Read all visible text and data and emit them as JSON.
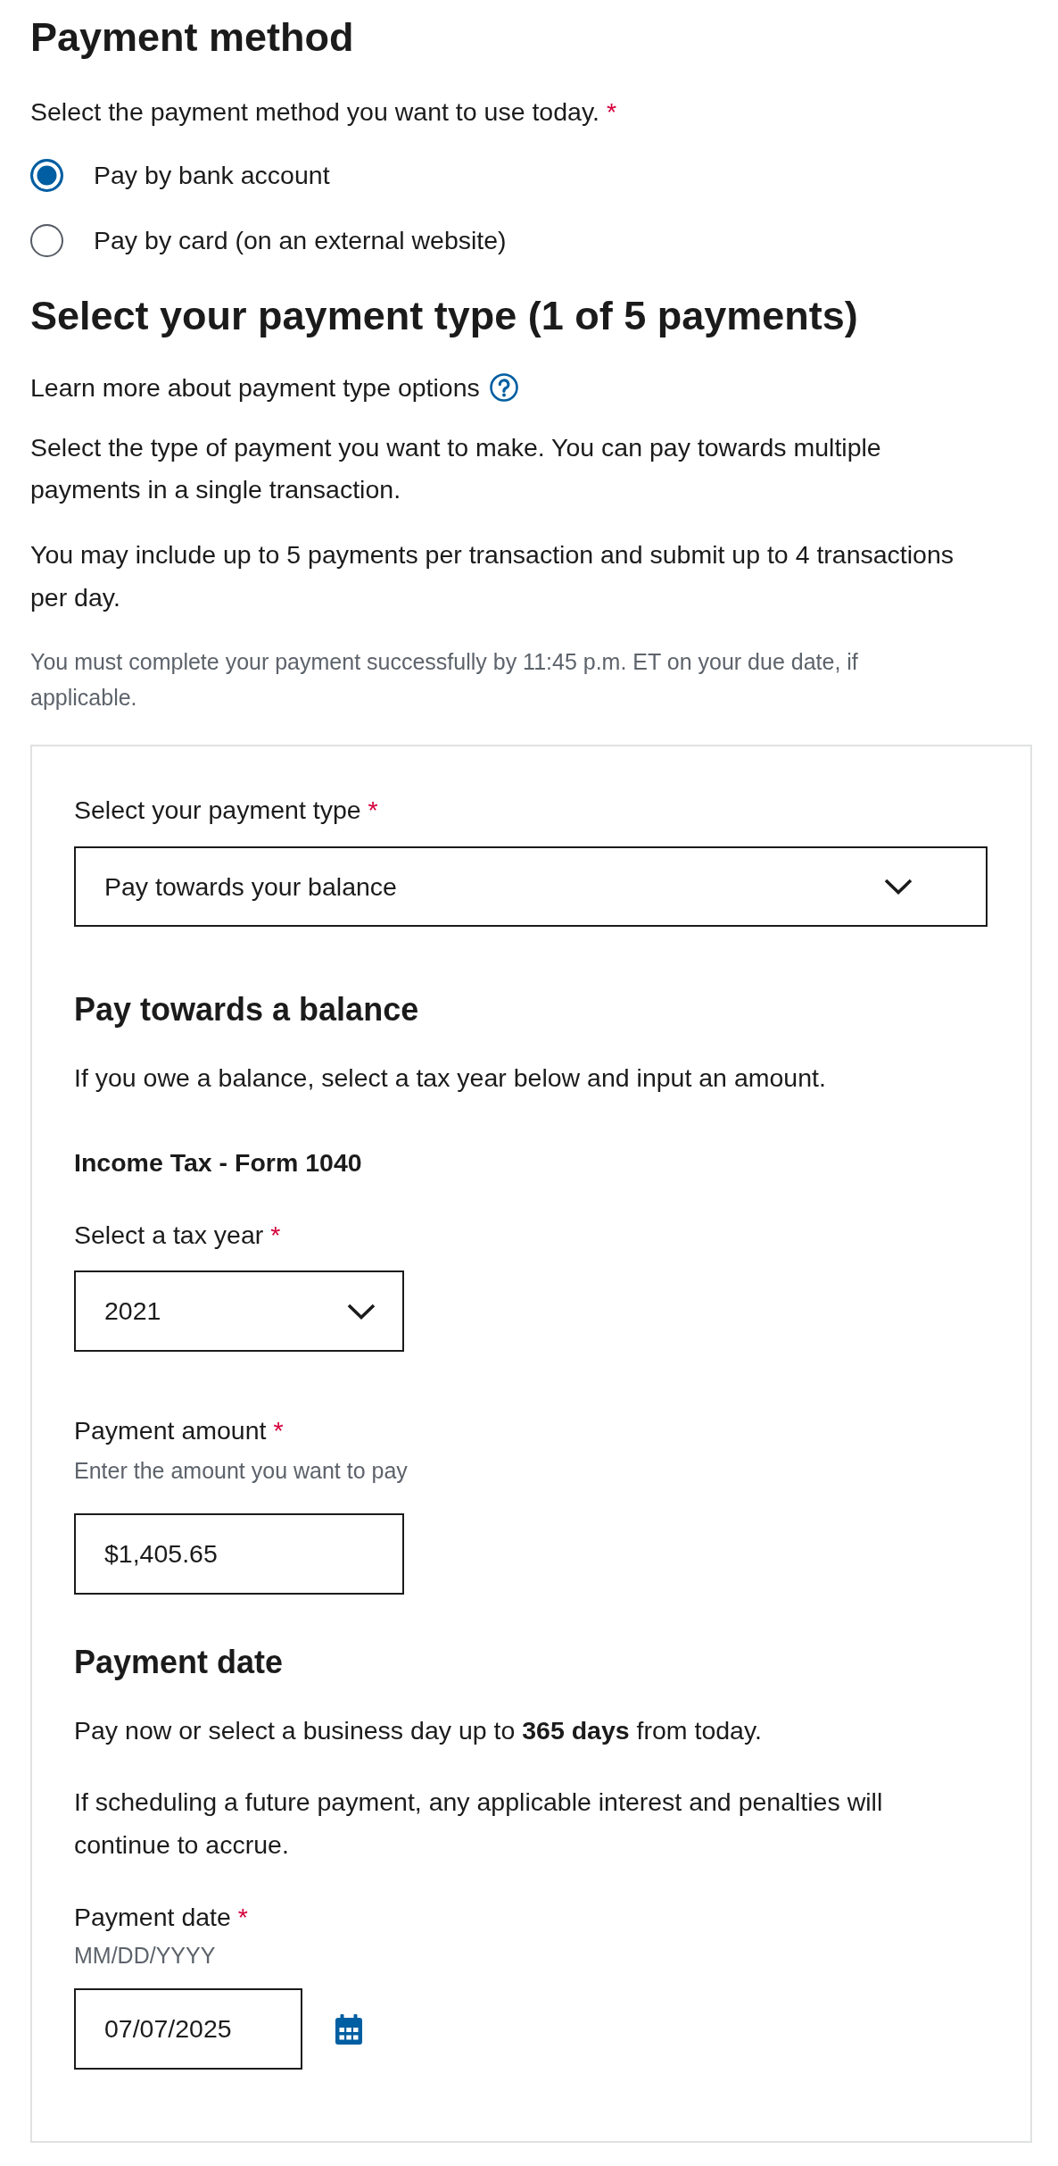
{
  "payment_method": {
    "heading": "Payment method",
    "prompt": "Select the payment method you want to use today.",
    "required_mark": "*",
    "options": [
      {
        "label": "Pay by bank account",
        "selected": true
      },
      {
        "label": "Pay by card (on an external website)",
        "selected": false
      }
    ]
  },
  "payment_type": {
    "heading": "Select your payment type (1 of 5 payments)",
    "help_text": "Learn more about payment type options",
    "paragraphs": [
      "Select the type of payment you want to make. You can pay towards multiple payments in a single transaction.",
      "You may include up to 5 payments per transaction and submit up to 4 transactions per day."
    ],
    "note": "You must complete your payment successfully by 11:45 p.m. ET on your due date, if applicable."
  },
  "payment_card": {
    "type_select": {
      "label": "Select your payment type",
      "required_mark": "*",
      "value": "Pay towards your balance"
    },
    "balance": {
      "heading": "Pay towards a balance",
      "description": "If you owe a balance, select a tax year below and input an amount.",
      "form_name": "Income Tax - Form 1040",
      "tax_year": {
        "label": "Select a tax year",
        "required_mark": "*",
        "value": "2021"
      },
      "amount": {
        "label": "Payment amount",
        "required_mark": "*",
        "hint": "Enter the amount you want to pay",
        "value": "$1,405.65"
      }
    },
    "date": {
      "heading": "Payment date",
      "paragraphs": [
        "Pay now or select a business day up to **365 days** from today.",
        "If scheduling a future payment, any applicable interest and penalties will continue to accrue."
      ],
      "field": {
        "label": "Payment date",
        "required_mark": "*",
        "hint": "MM/DD/YYYY",
        "value": "07/07/2025"
      }
    }
  }
}
